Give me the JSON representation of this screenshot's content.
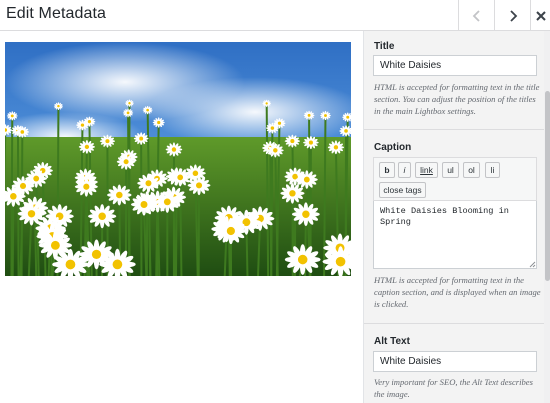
{
  "header": {
    "title": "Edit Metadata",
    "prev_icon": "chevron-left-icon",
    "next_icon": "chevron-right-icon",
    "close_icon": "close-icon"
  },
  "image": {
    "description_icon": "daisy-field-photo"
  },
  "sidebar": {
    "title_label": "Title",
    "title_value": "White Daisies",
    "title_help": "HTML is accepted for formatting text in the title section. You can adjust the position of the titles in the main Lightbox settings.",
    "caption_label": "Caption",
    "caption_buttons": [
      "b",
      "i",
      "link",
      "ul",
      "ol",
      "li"
    ],
    "close_tags_label": "close tags",
    "caption_value": "White Daisies Blooming in Spring",
    "caption_help": "HTML is accepted for formatting text in the caption section, and is displayed when an image is clicked.",
    "alt_label": "Alt Text",
    "alt_value": "White Daisies",
    "alt_help": "Very important for SEO, the Alt Text describes the image."
  },
  "colors": {
    "sidebar_bg": "#f3f3f3",
    "border": "#ccd0d4",
    "help_text": "#646970"
  }
}
